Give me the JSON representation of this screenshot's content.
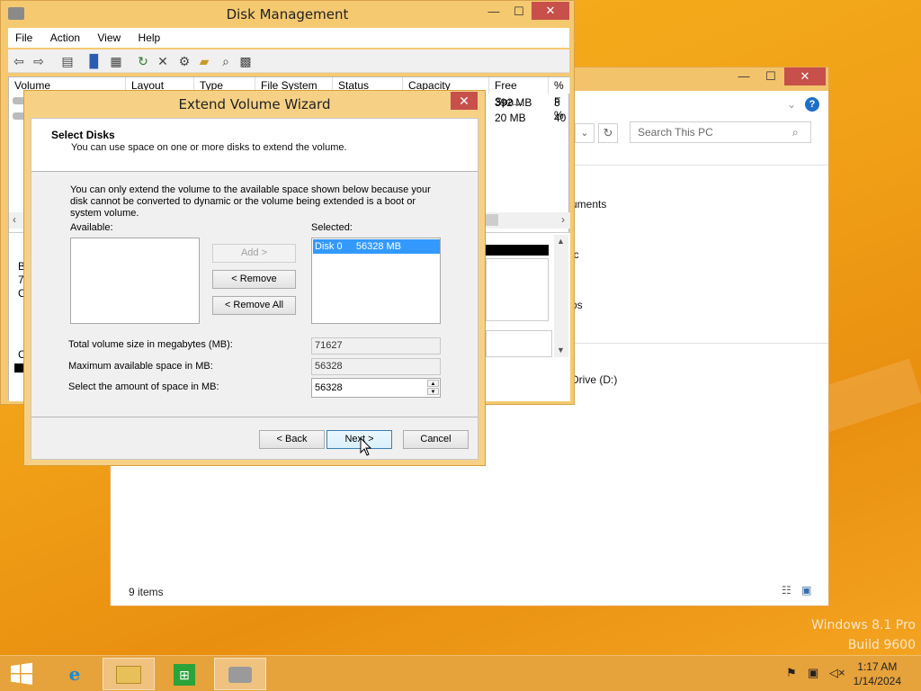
{
  "desktop": {
    "watermark_line1": "Windows 8.1 Pro",
    "watermark_line2": "Build 9600"
  },
  "explorer": {
    "search_placeholder": "Search This PC",
    "nav_items": [
      "uments",
      "ic",
      "os",
      "Drive (D:)"
    ],
    "status": "9 items",
    "window_controls": {
      "minimize": "—",
      "maximize": "☐",
      "close": "✕"
    }
  },
  "disk_management": {
    "title": "Disk Management",
    "menu": [
      "File",
      "Action",
      "View",
      "Help"
    ],
    "columns": [
      "Volume",
      "Layout",
      "Type",
      "File System",
      "Status",
      "Capacity",
      "Free Spa...",
      "% F"
    ],
    "rows": [
      {
        "free": "392 MB",
        "pct": "3 %"
      },
      {
        "free": "20 MB",
        "pct": "40"
      }
    ],
    "left_letters": [
      "B",
      "7",
      "C",
      "C"
    ],
    "window_controls": {
      "minimize": "—",
      "maximize": "☐",
      "close": "✕"
    }
  },
  "wizard": {
    "title": "Extend Volume Wizard",
    "close_label": "✕",
    "header_title": "Select Disks",
    "header_subtitle": "You can use space on one or more disks to extend the volume.",
    "description": "You can only extend the volume to the available space shown below because your disk cannot be converted to dynamic or the volume being extended is a boot or system volume.",
    "available_label": "Available:",
    "selected_label": "Selected:",
    "selected_items": [
      "Disk 0     56328 MB"
    ],
    "add_button": "Add >",
    "remove_button": "< Remove",
    "remove_all_button": "< Remove All",
    "total_label": "Total volume size in megabytes (MB):",
    "total_value": "71627",
    "max_label": "Maximum available space in MB:",
    "max_value": "56328",
    "amount_label": "Select the amount of space in MB:",
    "amount_value": "56328",
    "back_button": "< Back",
    "next_button": "Next >",
    "cancel_button": "Cancel"
  },
  "taskbar": {
    "time": "1:17 AM",
    "date": "1/14/2024",
    "items": [
      "start-icon",
      "internet-explorer-icon",
      "file-explorer-icon",
      "store-icon",
      "disk-management-icon"
    ]
  },
  "colors": {
    "accent": "#f0a017",
    "selection": "#3399ff",
    "close_red": "#c7504b"
  }
}
